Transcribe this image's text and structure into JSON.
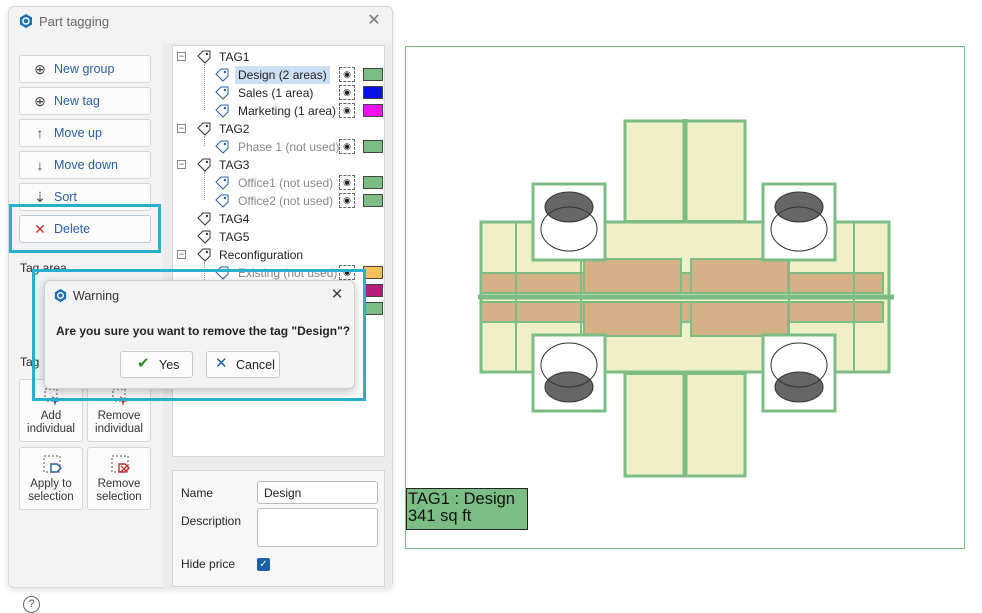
{
  "panel": {
    "title": "Part tagging"
  },
  "buttons": {
    "new_group": "New group",
    "new_tag": "New tag",
    "move_up": "Move up",
    "move_down": "Move down",
    "sort": "Sort",
    "delete": "Delete"
  },
  "sections": {
    "tag_area": "Tag area",
    "tag_parts": "Tag"
  },
  "action_buttons": {
    "add_individual": [
      "Add",
      "individual"
    ],
    "remove_individual": [
      "Remove",
      "individual"
    ],
    "apply_to_selection": [
      "Apply to",
      "selection"
    ],
    "remove_selection": [
      "Remove",
      "selection"
    ]
  },
  "tree": {
    "groups": [
      {
        "name": "TAG1",
        "children": [
          {
            "label": "Design (2 areas)",
            "color": "#7cbd85",
            "selected": true
          },
          {
            "label": "Sales (1 area)",
            "color": "#0a10e8"
          },
          {
            "label": "Marketing (1 area)",
            "color": "#ee12ee"
          }
        ]
      },
      {
        "name": "TAG2",
        "children": [
          {
            "label": "Phase 1 (not used)",
            "color": "#7cbd85"
          }
        ]
      },
      {
        "name": "TAG3",
        "children": [
          {
            "label": "Office1 (not used)",
            "color": "#7cbd85"
          },
          {
            "label": "Office2 (not used)",
            "color": "#7cbd85"
          }
        ]
      },
      {
        "name": "TAG4"
      },
      {
        "name": "TAG5"
      },
      {
        "name": "Reconfiguration",
        "children": [
          {
            "label": "Existing (not used)",
            "color": "#f6c15a"
          },
          {
            "label": "",
            "color": "#b41e7a"
          },
          {
            "label": "",
            "color": "#7cbd85"
          }
        ]
      }
    ]
  },
  "properties": {
    "name_label": "Name",
    "name_value": "Design",
    "description_label": "Description",
    "hide_price_label": "Hide price",
    "hide_price_checked": true
  },
  "dialog": {
    "title": "Warning",
    "message": "Are you sure you want to remove the tag \"Design\"?",
    "yes": "Yes",
    "cancel": "Cancel"
  },
  "drawing": {
    "tag_label_line1": "TAG1 : Design",
    "tag_label_line2": "341 sq ft",
    "tag_color": "#7cbd85",
    "table_color": "#efefc8",
    "desk_color": "#d6b187"
  }
}
